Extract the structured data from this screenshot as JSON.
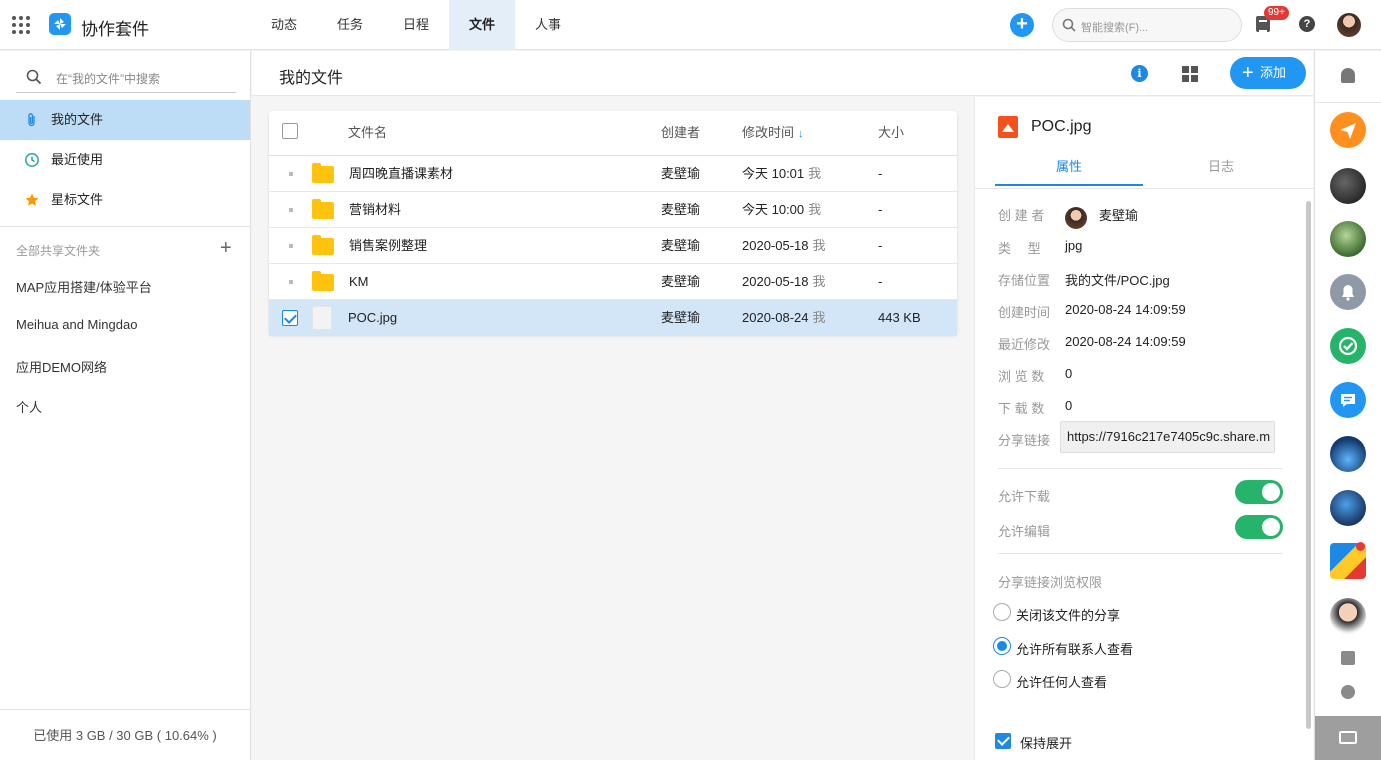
{
  "app": {
    "title": "协作套件"
  },
  "nav": {
    "tabs": [
      {
        "label": "动态"
      },
      {
        "label": "任务"
      },
      {
        "label": "日程"
      },
      {
        "label": "文件",
        "active": true
      },
      {
        "label": "人事"
      }
    ]
  },
  "topbar": {
    "search_placeholder": "智能搜索(F)...",
    "notification_badge": "99+",
    "help_label": "?"
  },
  "sidebar": {
    "search_placeholder": "在“我的文件”中搜索",
    "items": [
      {
        "label": "我的文件",
        "icon": "paperclip-icon",
        "active": true
      },
      {
        "label": "最近使用",
        "icon": "clock-icon"
      },
      {
        "label": "星标文件",
        "icon": "star-icon"
      }
    ],
    "shared_header": "全部共享文件夹",
    "shared_add": "+",
    "shared_folders": [
      {
        "label": "MAP应用搭建/体验平台"
      },
      {
        "label": "Meihua and Mingdao"
      },
      {
        "label": "应用DEMO网络"
      },
      {
        "label": "个人"
      }
    ],
    "storage": "已使用 3 GB / 30 GB ( 10.64% )"
  },
  "main": {
    "title": "我的文件",
    "add_button": "添加",
    "info_label": "i",
    "table": {
      "columns": {
        "name": "文件名",
        "creator": "创建者",
        "modified": "修改时间",
        "size": "大小",
        "sort_arrow": "↓"
      },
      "rows": [
        {
          "name": "周四晚直播课素材",
          "type": "folder",
          "creator": "麦壁瑜",
          "modified": "今天 10:01",
          "me": "我",
          "size": "-"
        },
        {
          "name": "营销材料",
          "type": "folder",
          "creator": "麦壁瑜",
          "modified": "今天 10:00",
          "me": "我",
          "size": "-"
        },
        {
          "name": "销售案例整理",
          "type": "folder",
          "creator": "麦壁瑜",
          "modified": "2020-05-18",
          "me": "我",
          "size": "-"
        },
        {
          "name": "KM",
          "type": "folder",
          "creator": "麦壁瑜",
          "modified": "2020-05-18",
          "me": "我",
          "size": "-"
        },
        {
          "name": "POC.jpg",
          "type": "image",
          "creator": "麦壁瑜",
          "modified": "2020-08-24",
          "me": "我",
          "size": "443 KB",
          "selected": true
        }
      ]
    }
  },
  "detail": {
    "filename": "POC.jpg",
    "tabs": {
      "properties": "属性",
      "log": "日志"
    },
    "props": {
      "creator_label": "创 建 者",
      "creator": "麦壁瑜",
      "type_label": "类　 型",
      "type": "jpg",
      "location_label": "存储位置",
      "location": "我的文件/POC.jpg",
      "created_label": "创建时间",
      "created": "2020-08-24 14:09:59",
      "modified_label": "最近修改",
      "modified": "2020-08-24 14:09:59",
      "views_label": "浏 览 数",
      "views": "0",
      "downloads_label": "下 载 数",
      "downloads": "0",
      "share_label": "分享链接",
      "share_link": "https://7916c217e7405c9c.share.m"
    },
    "allow_download": "允许下载",
    "allow_edit": "允许编辑",
    "share_permission_title": "分享链接浏览权限",
    "share_options": [
      {
        "label": "关闭该文件的分享",
        "selected": false
      },
      {
        "label": "允许所有联系人查看",
        "selected": true
      },
      {
        "label": "允许任何人查看",
        "selected": false
      }
    ],
    "keep_expanded": "保持展开"
  },
  "rail": {
    "icons": [
      "bell-icon",
      "send-icon",
      "avatar",
      "avatar",
      "bell-icon",
      "check-icon",
      "chat-icon",
      "avatar",
      "avatar",
      "avatar",
      "avatar",
      "contacts-icon",
      "add-chat-icon",
      "collapse-icon"
    ]
  },
  "colors": {
    "accent": "#2196f3",
    "selected_row": "#d2e6f8",
    "sidebar_active": "#bddcf6",
    "toggle_on": "#26b36a",
    "folder": "#ffc20e"
  }
}
